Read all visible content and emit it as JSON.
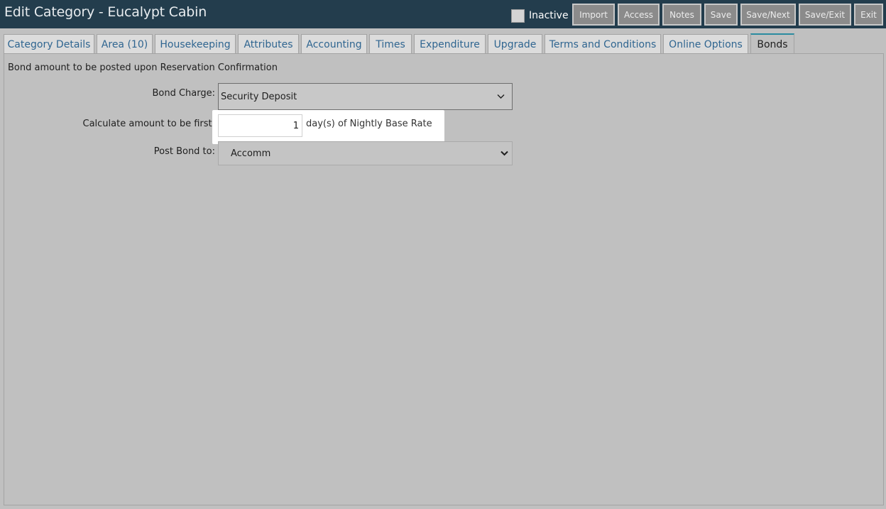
{
  "header": {
    "title": "Edit Category - Eucalypt Cabin",
    "inactive_label": "Inactive",
    "inactive_checked": false,
    "buttons": {
      "import": "Import",
      "access": "Access",
      "notes": "Notes",
      "save": "Save",
      "save_next": "Save/Next",
      "save_exit": "Save/Exit",
      "exit": "Exit"
    }
  },
  "tabs": {
    "category_details": "Category Details",
    "area": "Area (10)",
    "housekeeping": "Housekeeping",
    "attributes": "Attributes",
    "accounting": "Accounting",
    "times": "Times",
    "expenditure": "Expenditure",
    "upgrade": "Upgrade",
    "terms": "Terms and Conditions",
    "online": "Online Options",
    "bonds": "Bonds",
    "active": "Bonds"
  },
  "bonds": {
    "heading": "Bond amount to be posted upon Reservation Confirmation",
    "bond_charge_label": "Bond Charge:",
    "bond_charge_value": "Security Deposit",
    "calc_label": "Calculate amount to be first:",
    "calc_value": "1",
    "calc_suffix": "day(s) of Nightly Base Rate",
    "post_label": "Post Bond to:",
    "post_value": "Accomm"
  },
  "icons": {
    "dropdown": "chevron-down-icon"
  },
  "colors": {
    "header_bg": "#233d4d",
    "body_bg": "#c0c0c0",
    "tab_text": "#2f6590",
    "active_tab_accent": "#2a8ba0",
    "button_bg": "#8b8b8b"
  }
}
